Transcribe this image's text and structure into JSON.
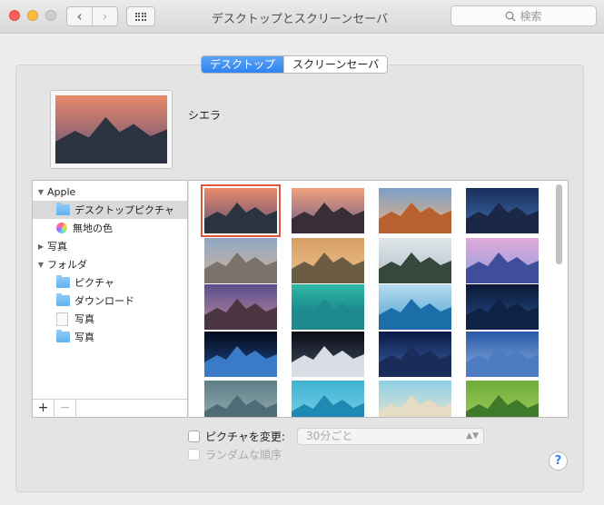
{
  "window": {
    "title": "デスクトップとスクリーンセーバ"
  },
  "toolbar": {
    "back_label": "‹",
    "forward_label": "›",
    "search_placeholder": "検索"
  },
  "tabs": [
    {
      "label": "デスクトップ",
      "selected": true
    },
    {
      "label": "スクリーンセーバ",
      "selected": false
    }
  ],
  "preview": {
    "name": "シエラ"
  },
  "sidebar": {
    "items": [
      {
        "label": "Apple",
        "kind": "group",
        "expanded": true
      },
      {
        "label": "デスクトップピクチャ",
        "kind": "folder",
        "selected": true
      },
      {
        "label": "無地の色",
        "kind": "colors"
      },
      {
        "label": "写真",
        "kind": "group",
        "expanded": false
      },
      {
        "label": "フォルダ",
        "kind": "group",
        "expanded": true
      },
      {
        "label": "ピクチャ",
        "kind": "folder"
      },
      {
        "label": "ダウンロード",
        "kind": "folder"
      },
      {
        "label": "写真",
        "kind": "document"
      },
      {
        "label": "写真",
        "kind": "folder"
      }
    ],
    "add_label": "+",
    "remove_label": "−"
  },
  "wallpapers": [
    {
      "name": "sierra",
      "sky": [
        "#e98a6b",
        "#5a4e76"
      ],
      "ground": "#2b3240",
      "selected": true
    },
    {
      "name": "sierra-2",
      "sky": [
        "#f0a07d",
        "#6a5a86"
      ],
      "ground": "#3a2e36"
    },
    {
      "name": "el-capitan",
      "sky": [
        "#7aa0c8",
        "#f2b27a"
      ],
      "ground": "#b8602e"
    },
    {
      "name": "yosemite-night",
      "sky": [
        "#1b2e5c",
        "#3c6fb0"
      ],
      "ground": "#1a2748"
    },
    {
      "name": "yosemite",
      "sky": [
        "#8ea8c4",
        "#d3b49a"
      ],
      "ground": "#7b736b"
    },
    {
      "name": "el-capitan-2",
      "sky": [
        "#d9a066",
        "#e9c28d"
      ],
      "ground": "#6b5c43"
    },
    {
      "name": "yosemite-mist",
      "sky": [
        "#dfe6ea",
        "#b0bec6"
      ],
      "ground": "#36483e"
    },
    {
      "name": "half-dome",
      "sky": [
        "#e0a8d8",
        "#8fa0e0"
      ],
      "ground": "#3f4d9a"
    },
    {
      "name": "lake-stones",
      "sky": [
        "#5b4e8f",
        "#c08a9a"
      ],
      "ground": "#4a3540"
    },
    {
      "name": "wave-green",
      "sky": [
        "#2fb9a4",
        "#0f6a86"
      ],
      "ground": "#1f8a8e"
    },
    {
      "name": "wave-blue",
      "sky": [
        "#b7dcef",
        "#4ba0d0"
      ],
      "ground": "#1c6ea8"
    },
    {
      "name": "galaxy",
      "sky": [
        "#0b1736",
        "#27508e"
      ],
      "ground": "#0f2244"
    },
    {
      "name": "earth-horizon",
      "sky": [
        "#050b1c",
        "#1d4a8c"
      ],
      "ground": "#3a7bc8"
    },
    {
      "name": "earth-orbit",
      "sky": [
        "#0c0c14",
        "#40506a"
      ],
      "ground": "#d8dde6"
    },
    {
      "name": "milky-way",
      "sky": [
        "#0b1a46",
        "#3a63a8"
      ],
      "ground": "#1a2c5a"
    },
    {
      "name": "moon-sky",
      "sky": [
        "#2a5aa8",
        "#8cb2e0"
      ],
      "ground": "#4d7cc2"
    },
    {
      "name": "clouds",
      "sky": [
        "#5e7e88",
        "#9db2b6"
      ],
      "ground": "#4c6c76"
    },
    {
      "name": "water-pattern",
      "sky": [
        "#3fb2d2",
        "#7fd4ea"
      ],
      "ground": "#1e8ab4"
    },
    {
      "name": "beach",
      "sky": [
        "#8fd0e6",
        "#efe4cc"
      ],
      "ground": "#e6dcc4"
    },
    {
      "name": "rice-fields",
      "sky": [
        "#6eac3a",
        "#a4cf5c"
      ],
      "ground": "#3f7a2a"
    }
  ],
  "options": {
    "change_picture_label": "ピクチャを変更:",
    "interval_value": "30分ごと",
    "random_order_label": "ランダムな順序",
    "help_label": "?"
  }
}
